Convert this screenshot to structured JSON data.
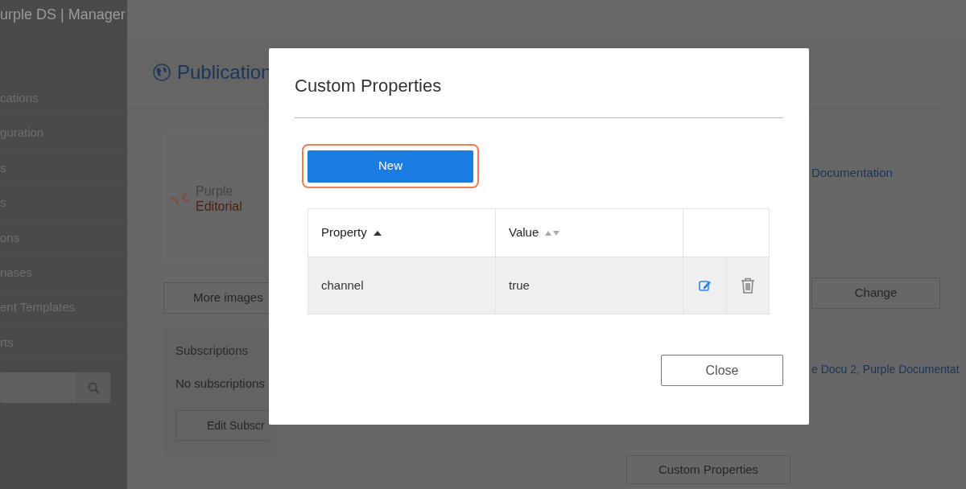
{
  "app": {
    "title": "urple DS | Manager"
  },
  "sidebar": {
    "items": [
      "cations",
      "guration",
      "s",
      "s",
      "ons",
      "nases",
      "ent Templates",
      "rts"
    ]
  },
  "page": {
    "title": "Publication",
    "logo": {
      "line_1": "Purple",
      "line_2": "Editorial"
    },
    "more_images_button": "More images",
    "subscriptions": {
      "title": "Subscriptions",
      "empty_text": "No subscriptions",
      "button": "Edit Subscr"
    },
    "custom_properties_button": "Custom Properties",
    "documentation_link": "Documentation",
    "change_button": "Change",
    "linked_publications": "e Docu 2, Purple Documentat"
  },
  "modal": {
    "title": "Custom Properties",
    "new_button": "New",
    "columns": [
      {
        "label": "Property",
        "sorted": true
      },
      {
        "label": "Value",
        "sorted": false
      }
    ],
    "rows": [
      {
        "property": "channel",
        "value": "true"
      }
    ],
    "close_button": "Close"
  }
}
